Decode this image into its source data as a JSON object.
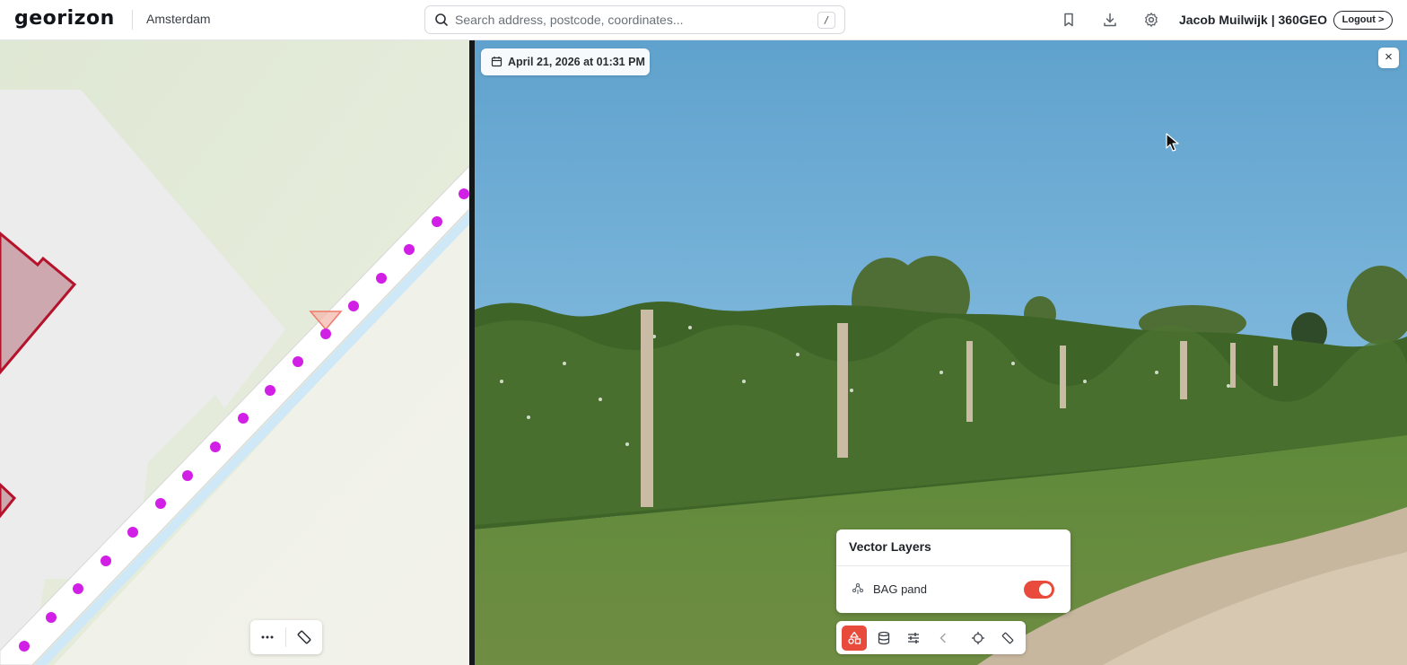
{
  "header": {
    "logo": "georizon",
    "city": "Amsterdam",
    "search_placeholder": "Search address, postcode, coordinates...",
    "search_shortcut": "/",
    "user": "Jacob Muilwijk | 360GEO",
    "logout_label": "Logout >",
    "icons": [
      "bookmark-icon",
      "download-icon",
      "settings-icon"
    ]
  },
  "map": {
    "toolbar_icons": [
      "more-icon",
      "measure-icon"
    ],
    "accent_point_color": "#d21fe6",
    "building_outline_color": "#b5122c",
    "viewpoint_color": "#f07a6a"
  },
  "street_view": {
    "capture_date": "April 21, 2026 at 01:31 PM",
    "close_label": "×"
  },
  "vector_layers": {
    "title": "Vector Layers",
    "items": [
      {
        "label": "BAG pand",
        "enabled": true
      }
    ]
  },
  "bottom_toolbar": {
    "buttons": [
      "layers-shapes-icon",
      "database-icon",
      "sliders-icon",
      "chevron-left-icon",
      "crosshair-icon",
      "ruler-icon"
    ],
    "active_index": 0,
    "accent": "#e84a3c"
  }
}
